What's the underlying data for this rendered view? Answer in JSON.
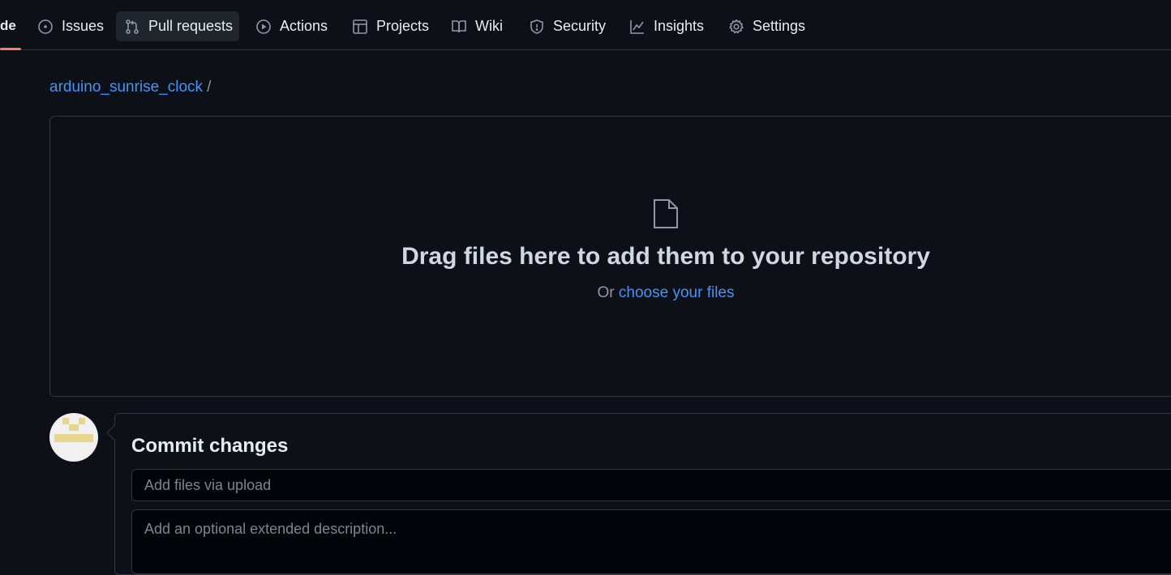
{
  "nav": {
    "partial_tab_label": "de",
    "tabs": [
      {
        "label": "Issues",
        "icon": "issue-opened-icon",
        "active": false
      },
      {
        "label": "Pull requests",
        "icon": "git-pull-request-icon",
        "active": true
      },
      {
        "label": "Actions",
        "icon": "play-icon",
        "active": false
      },
      {
        "label": "Projects",
        "icon": "table-icon",
        "active": false
      },
      {
        "label": "Wiki",
        "icon": "book-icon",
        "active": false
      },
      {
        "label": "Security",
        "icon": "shield-icon",
        "active": false
      },
      {
        "label": "Insights",
        "icon": "graph-icon",
        "active": false
      },
      {
        "label": "Settings",
        "icon": "gear-icon",
        "active": false
      }
    ]
  },
  "breadcrumb": {
    "repo": "arduino_sunrise_clock",
    "separator": "/"
  },
  "dropzone": {
    "icon": "file-icon",
    "title": "Drag files here to add them to your repository",
    "prefix": "Or",
    "link": "choose your files"
  },
  "commit": {
    "avatar_icon": "identicon-avatar",
    "title": "Commit changes",
    "summary_placeholder": "Add files via upload",
    "description_placeholder": "Add an optional extended description..."
  },
  "colors": {
    "background": "#0d1117",
    "border": "#30363d",
    "link": "#4493f8",
    "active_underline": "#f78166",
    "avatar_accent": "#e8d48a"
  }
}
